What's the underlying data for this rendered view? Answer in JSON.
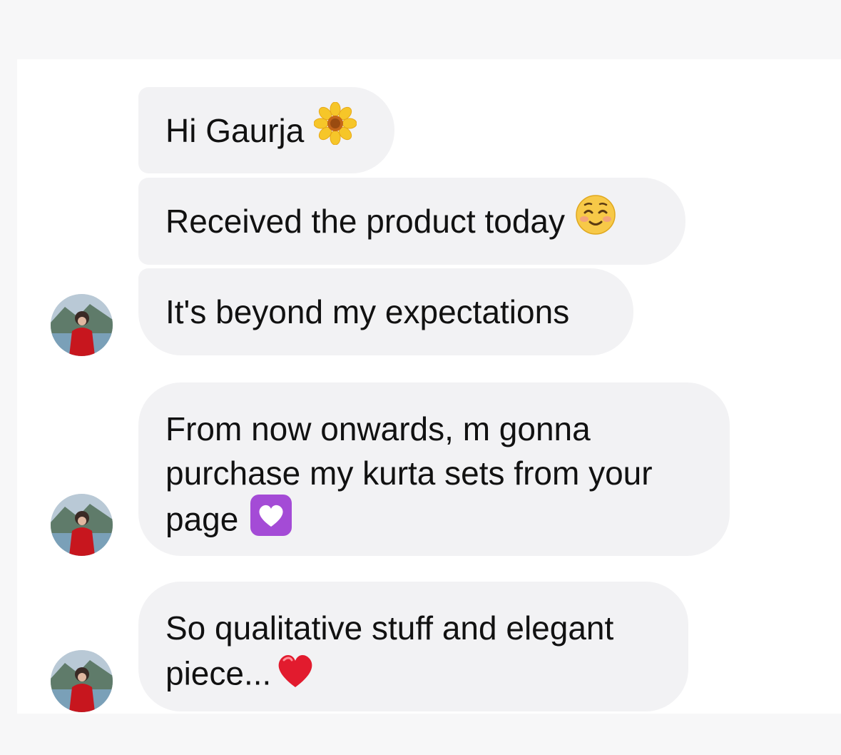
{
  "messages": [
    {
      "text": "Hi Gaurja",
      "emoji": "sunflower-icon"
    },
    {
      "text": "Received the product today",
      "emoji": "smiling-face-icon"
    },
    {
      "text": "It's beyond my expectations"
    },
    {
      "lines": [
        "From now onwards, m gonna",
        "purchase my kurta sets from your",
        "page"
      ],
      "emoji": "purple-heart-icon"
    },
    {
      "lines": [
        "So qualitative stuff and elegant",
        "piece..."
      ],
      "emoji": "red-heart-icon"
    }
  ],
  "colors": {
    "page_bg": "#f7f7f8",
    "panel_bg": "#ffffff",
    "bubble_bg": "#f2f2f4",
    "text": "#111111",
    "heart_red": "#e21b2e",
    "heart_purple": "#a44bd6",
    "sunflower_petal": "#f6c629",
    "smile_yellow": "#f7c948"
  }
}
